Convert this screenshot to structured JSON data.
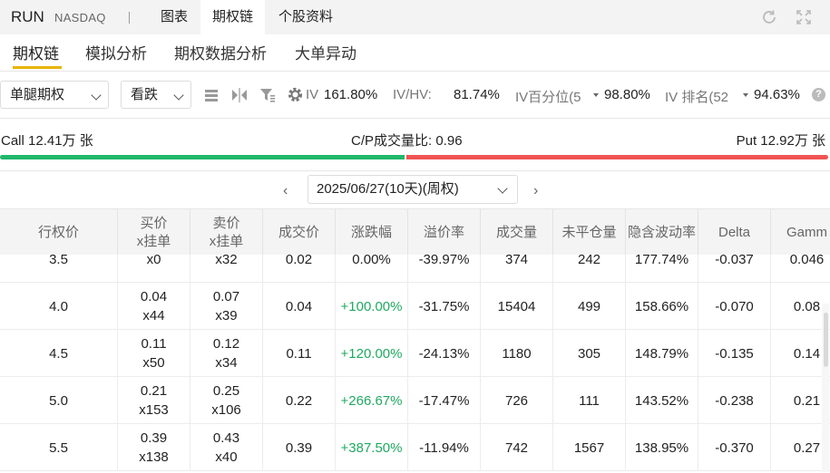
{
  "header": {
    "ticker": "RUN",
    "exchange": "NASDAQ",
    "tabs": [
      {
        "label": "图表",
        "active": false
      },
      {
        "label": "期权链",
        "active": true
      },
      {
        "label": "个股资料",
        "active": false
      }
    ],
    "icons": [
      "refresh-icon",
      "expand-icon"
    ]
  },
  "subtabs": [
    {
      "label": "期权链",
      "active": true
    },
    {
      "label": "模拟分析",
      "active": false
    },
    {
      "label": "期权数据分析",
      "active": false
    },
    {
      "label": "大单异动",
      "active": false
    }
  ],
  "toolbar": {
    "leg_select": "单腿期权",
    "direction_select": "看跌",
    "icons": [
      "list-view-icon",
      "compare-icon",
      "filter-icon",
      "settings-icon"
    ],
    "iv_label": "IV",
    "iv_value": "161.80%",
    "ivhv_label": "IV/HV:",
    "ivhv_value": "81.74%",
    "iv_pct_label": "IV百分位(5",
    "iv_pct_value": "98.80%",
    "iv_rank_label": "IV 排名(52",
    "iv_rank_value": "94.63%",
    "help": "?"
  },
  "volume": {
    "call_label": "Call 12.41万 张",
    "ratio_label": "C/P成交量比: 0.96",
    "put_label": "Put 12.92万 张",
    "call_share": 0.49,
    "colors": {
      "call": "#20b86c",
      "put": "#f05454"
    }
  },
  "expiry": {
    "value": "2025/06/27(10天)(周权)",
    "prev": "‹",
    "next": "›"
  },
  "table": {
    "headers": [
      [
        "行权价"
      ],
      [
        "买价",
        "x挂单"
      ],
      [
        "卖价",
        "x挂单"
      ],
      [
        "成交价"
      ],
      [
        "涨跌幅"
      ],
      [
        "溢价率"
      ],
      [
        "成交量"
      ],
      [
        "未平仓量"
      ],
      [
        "隐含波动率"
      ],
      [
        "Delta"
      ],
      [
        "Gamm"
      ]
    ],
    "rows": [
      {
        "strike": "3.5",
        "bid": "",
        "bid_size": "x0",
        "ask": "",
        "ask_size": "x32",
        "last": "0.02",
        "change": "0.00%",
        "change_up": false,
        "premium": "-39.97%",
        "volume": "374",
        "oi": "242",
        "iv": "177.74%",
        "delta": "-0.037",
        "gamma": "0.046"
      },
      {
        "strike": "4.0",
        "bid": "0.04",
        "bid_size": "x44",
        "ask": "0.07",
        "ask_size": "x39",
        "last": "0.04",
        "change": "+100.00%",
        "change_up": true,
        "premium": "-31.75%",
        "volume": "15404",
        "oi": "499",
        "iv": "158.66%",
        "delta": "-0.070",
        "gamma": "0.08"
      },
      {
        "strike": "4.5",
        "bid": "0.11",
        "bid_size": "x50",
        "ask": "0.12",
        "ask_size": "x34",
        "last": "0.11",
        "change": "+120.00%",
        "change_up": true,
        "premium": "-24.13%",
        "volume": "1180",
        "oi": "305",
        "iv": "148.79%",
        "delta": "-0.135",
        "gamma": "0.14"
      },
      {
        "strike": "5.0",
        "bid": "0.21",
        "bid_size": "x153",
        "ask": "0.25",
        "ask_size": "x106",
        "last": "0.22",
        "change": "+266.67%",
        "change_up": true,
        "premium": "-17.47%",
        "volume": "726",
        "oi": "111",
        "iv": "143.52%",
        "delta": "-0.238",
        "gamma": "0.21"
      },
      {
        "strike": "5.5",
        "bid": "0.39",
        "bid_size": "x138",
        "ask": "0.43",
        "ask_size": "x40",
        "last": "0.39",
        "change": "+387.50%",
        "change_up": true,
        "premium": "-11.94%",
        "volume": "742",
        "oi": "1567",
        "iv": "138.95%",
        "delta": "-0.370",
        "gamma": "0.27"
      }
    ]
  }
}
